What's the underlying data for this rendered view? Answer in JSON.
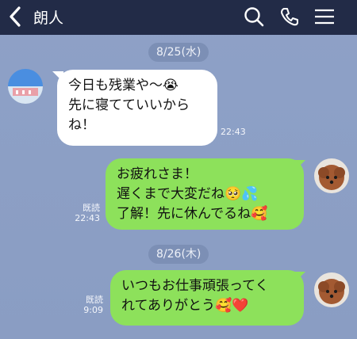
{
  "header": {
    "title": "朗人"
  },
  "dates": [
    "8/25(水)",
    "8/26(木)"
  ],
  "messages": [
    {
      "side": "left",
      "text": "今日も残業や〜😭\n先に寝てていいから\nね！",
      "time": "22:43"
    },
    {
      "side": "right",
      "text": "お疲れさま！\n遅くまで大変だね🥺💦\n了解！先に休んでるね🥰",
      "read": "既読",
      "time": "22:43"
    },
    {
      "side": "right",
      "text": "いつもお仕事頑張ってく\nれてありがとう🥰❤️",
      "read": "既読",
      "time": "9:09"
    }
  ],
  "colors": {
    "header": "#222b47",
    "background": "#8ea1c7",
    "sent_bubble": "#8de15b",
    "received_bubble": "#ffffff"
  },
  "icons": [
    "back-chevron-icon",
    "search-icon",
    "phone-icon",
    "menu-icon"
  ]
}
